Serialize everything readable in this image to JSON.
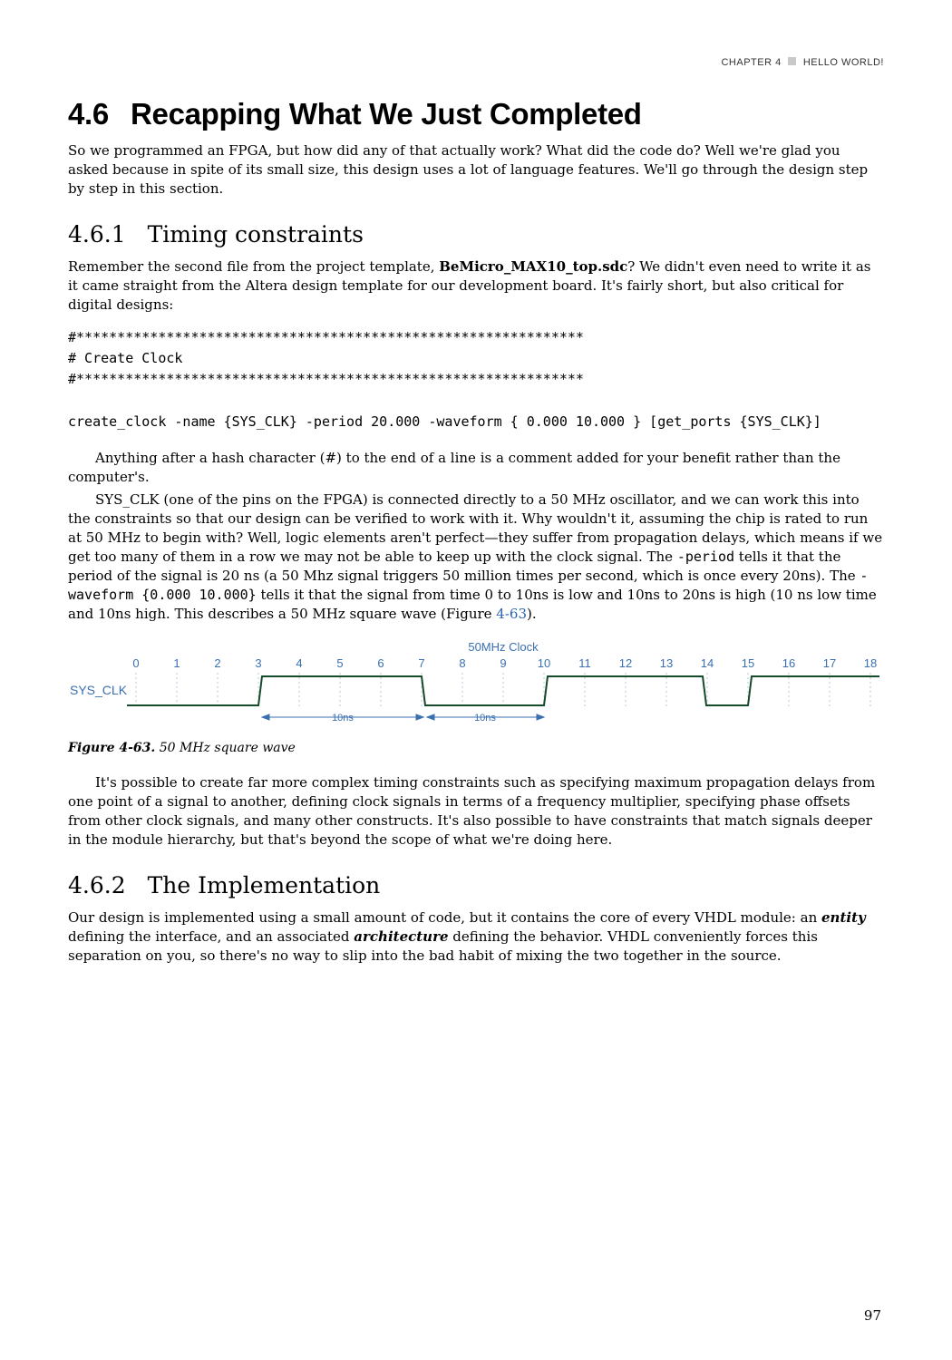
{
  "running_head": {
    "left": "CHAPTER 4",
    "right": "HELLO WORLD!"
  },
  "h1": {
    "num": "4.6",
    "title": "Recapping What We Just Completed"
  },
  "intro": "So we programmed an FPGA, but how did any of that actually work? What did the code do? Well we're glad you asked because in spite of its small size, this design uses a lot of language features. We'll go through the design step by step in this section.",
  "s461": {
    "num": "4.6.1",
    "title": "Timing constraints",
    "p1a": "Remember the second file from the project template, ",
    "p1bold": "BeMicro_MAX10_top.sdc",
    "p1b": "? We didn't even need to write it as it came straight from the Altera design template for our development board. It's fairly short, but also critical for digital designs:",
    "code": "#**************************************************************\n# Create Clock\n#**************************************************************\n\ncreate_clock -name {SYS_CLK} -period 20.000 -waveform { 0.000 10.000 } [get_ports {SYS_CLK}]",
    "p2": "Anything after a hash character (#) to the end of a line is a comment added for your benefit rather than the computer's.",
    "p3a": "SYS_CLK (one of the pins on the FPGA) is connected directly to a 50 MHz oscillator, and we can work this into the constraints so that our design can be verified to work with it. Why wouldn't it, assuming the chip is rated to run at 50 MHz to begin with? Well, logic elements aren't perfect—they suffer from propagation delays, which means if we get too many of them in a row we may not be able to keep up with the clock signal. The ",
    "p3code1": "-period",
    "p3b": " tells it that the period of the signal is 20 ns (a 50 Mhz signal triggers 50 million times per second, which is once every 20ns). The ",
    "p3code2": "-waveform {0.000 10.000}",
    "p3c": " tells it that the signal from time 0 to 10ns is low and 10ns to 20ns is high (10 ns low time and 10ns high. This describes a 50 MHz square wave (Figure ",
    "p3link": "4-63",
    "p3d": ").",
    "p4": "It's possible to create far more complex timing constraints such as specifying maximum propagation delays from one point of a signal to another, defining clock signals in terms of a frequency multiplier, specifying phase offsets from other clock signals, and many other constructs. It's also possible to have constraints that match signals deeper in the module hierarchy, but that's beyond the scope of what we're doing here."
  },
  "figure": {
    "title": "50MHz Clock",
    "signal_label": "SYS_CLK",
    "ticks": [
      "0",
      "1",
      "2",
      "3",
      "4",
      "5",
      "6",
      "7",
      "8",
      "9",
      "10",
      "11",
      "12",
      "13",
      "14",
      "15",
      "16",
      "17",
      "18"
    ],
    "dim1": "10ns",
    "dim2": "10ns",
    "caption_label": "Figure 4-63.",
    "caption_text": "50 MHz square wave"
  },
  "s462": {
    "num": "4.6.2",
    "title": "The Implementation",
    "p1a": "Our design is implemented using a small amount of code, but it contains the core of every VHDL module: an ",
    "p1em1": "entity",
    "p1b": " defining the interface, and an associated ",
    "p1em2": "architecture",
    "p1c": " defining the behavior. VHDL conveniently forces this separation on you, so there's no way to slip into the bad habit of mixing the two together in the source."
  },
  "page_number": "97",
  "chart_data": {
    "type": "timing-diagram",
    "title": "50MHz Clock",
    "signals": [
      {
        "name": "SYS_CLK",
        "period_ns": 20,
        "duty_cycle": 0.5,
        "low_time_ns": 10,
        "high_time_ns": 10
      }
    ],
    "x_ticks": [
      0,
      1,
      2,
      3,
      4,
      5,
      6,
      7,
      8,
      9,
      10,
      11,
      12,
      13,
      14,
      15,
      16,
      17,
      18
    ],
    "transitions_approx": [
      3,
      7,
      10,
      14
    ],
    "annotations": [
      {
        "label": "10ns",
        "from_tick": 3,
        "to_tick": 7
      },
      {
        "label": "10ns",
        "from_tick": 7,
        "to_tick": 10
      }
    ]
  }
}
